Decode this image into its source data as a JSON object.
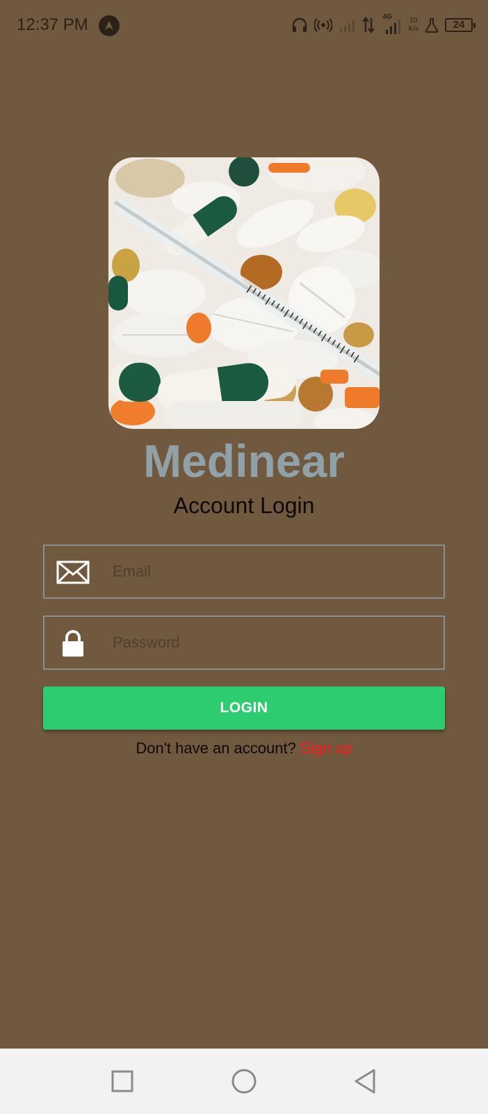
{
  "status_bar": {
    "time": "12:37 PM",
    "network_type": "4G",
    "speed_value": "10",
    "speed_unit": "K/s",
    "battery": "24"
  },
  "app": {
    "brand": "Medinear",
    "subtitle": "Account Login"
  },
  "form": {
    "email": {
      "value": "",
      "placeholder": "Email",
      "icon": "envelope-icon"
    },
    "password": {
      "value": "",
      "placeholder": "Password",
      "icon": "lock-icon"
    },
    "login_label": "LOGIN",
    "signup_prompt": "Don't have an account?",
    "signup_link": "Sign up"
  },
  "nav_bar": {
    "recent_icon": "square-icon",
    "home_icon": "circle-icon",
    "back_icon": "triangle-back-icon"
  },
  "colors": {
    "background": "#715940",
    "brand": "#91a1a9",
    "login_button": "#2ecc71",
    "signup_link": "#ff1a1a",
    "nav_bar": "#f2f2f2"
  }
}
